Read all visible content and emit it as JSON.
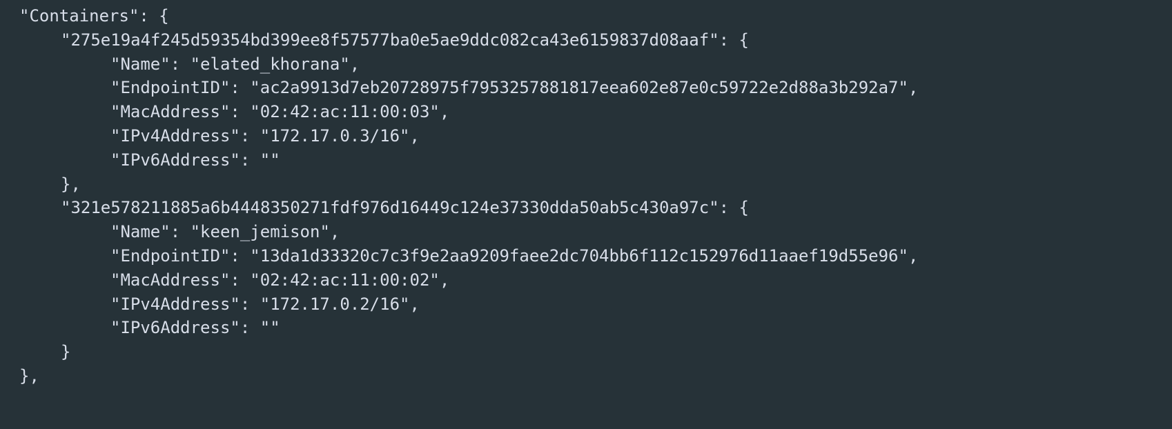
{
  "root_key": "Containers",
  "containers": [
    {
      "id": "275e19a4f245d59354bd399ee8f57577ba0e5ae9ddc082ca43e6159837d08aaf",
      "Name": "elated_khorana",
      "EndpointID": "ac2a9913d7eb20728975f7953257881817eea602e87e0c59722e2d88a3b292a7",
      "MacAddress": "02:42:ac:11:00:03",
      "IPv4Address": "172.17.0.3/16",
      "IPv6Address": ""
    },
    {
      "id": "321e578211885a6b4448350271fdf976d16449c124e37330dda50ab5c430a97c",
      "Name": "keen_jemison",
      "EndpointID": "13da1d33320c7c3f9e2aa9209faee2dc704bb6f112c152976d11aaef19d55e96",
      "MacAddress": "02:42:ac:11:00:02",
      "IPv4Address": "172.17.0.2/16",
      "IPv6Address": ""
    }
  ]
}
